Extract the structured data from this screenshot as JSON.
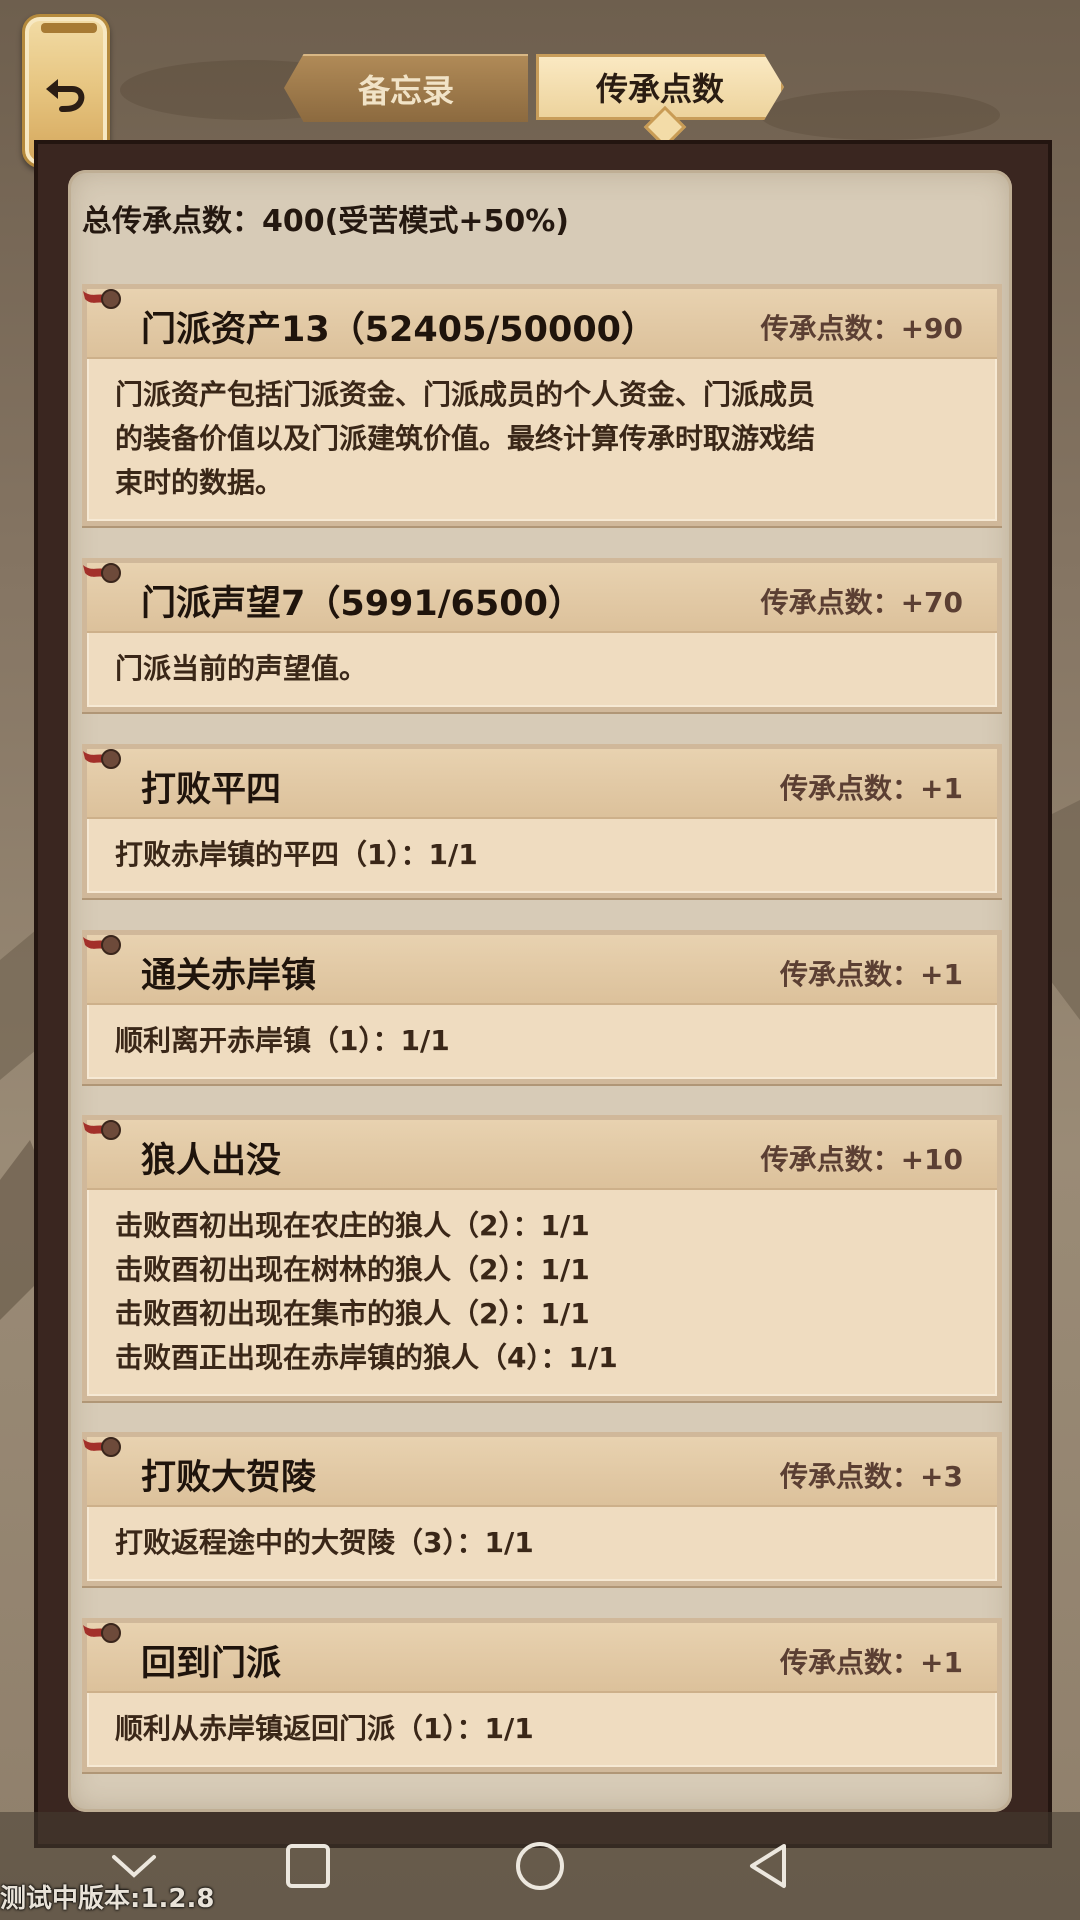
{
  "header": {
    "tabs": [
      {
        "label": "备忘录",
        "active": false
      },
      {
        "label": "传承点数",
        "active": true
      }
    ]
  },
  "total_points": "总传承点数：400(受苦模式+50%)",
  "cards": [
    {
      "title": "门派资产13（52405/50000）",
      "points": "传承点数：+90",
      "lines": [
        "门派资产包括门派资金、门派成员的个人资金、门派成员",
        "的装备价值以及门派建筑价值。最终计算传承时取游戏结",
        "束时的数据。"
      ]
    },
    {
      "title": "门派声望7（5991/6500）",
      "points": "传承点数：+70",
      "lines": [
        "门派当前的声望值。"
      ]
    },
    {
      "title": "打败平四",
      "points": "传承点数：+1",
      "lines": [
        "打败赤岸镇的平四（1）：1/1"
      ]
    },
    {
      "title": "通关赤岸镇",
      "points": "传承点数：+1",
      "lines": [
        "顺利离开赤岸镇（1）：1/1"
      ]
    },
    {
      "title": "狼人出没",
      "points": "传承点数：+10",
      "lines": [
        "击败酉初出现在农庄的狼人（2）：1/1",
        "击败酉初出现在树林的狼人（2）：1/1",
        "击败酉初出现在集市的狼人（2）：1/1",
        "击败酉正出现在赤岸镇的狼人（4）：1/1"
      ]
    },
    {
      "title": "打败大贺陵",
      "points": "传承点数：+3",
      "lines": [
        "打败返程途中的大贺陵（3）：1/1"
      ]
    },
    {
      "title": "回到门派",
      "points": "传承点数：+1",
      "lines": [
        "顺利从赤岸镇返回门派（1）：1/1"
      ]
    }
  ],
  "footer": {
    "version": "测试中版本:1.2.8"
  },
  "icons": {
    "back": "back-arrow-icon",
    "nav": [
      "chevron-down-icon",
      "square-icon",
      "circle-icon",
      "triangle-back-icon"
    ]
  },
  "colors": {
    "accent": "#e6c47f",
    "board": "#3a2620",
    "card": "#efdcc0",
    "points_text": "#5b3f33"
  }
}
